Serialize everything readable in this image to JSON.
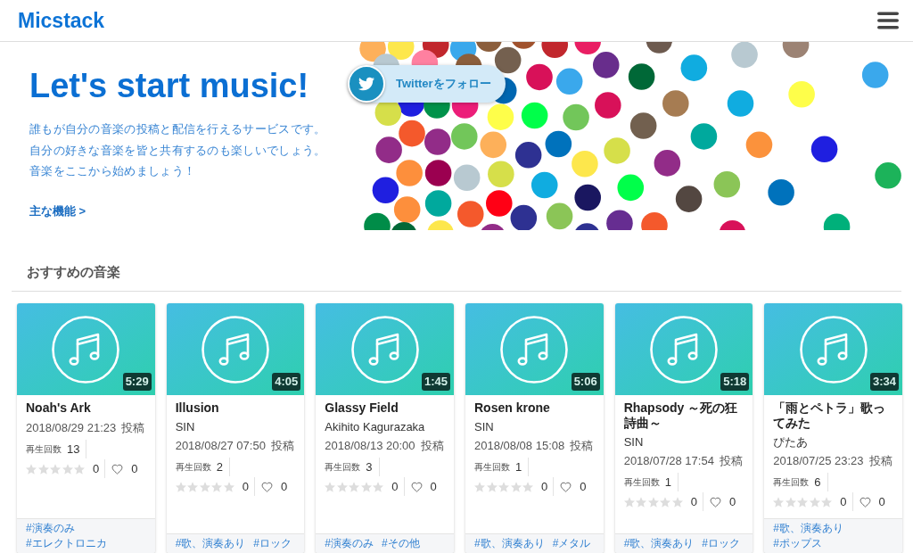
{
  "header": {
    "logo": "Micstack"
  },
  "hero": {
    "title": "Let's start music!",
    "description": [
      "誰もが自分の音楽の投稿と配信を行えるサービスです。",
      "自分の好きな音楽を皆と共有するのも楽しいでしょう。",
      "音楽をここから始めましょう！"
    ],
    "link": "主な機能 >",
    "twitter_button": "Twitterをフォロー"
  },
  "recommended": {
    "title": "おすすめの音楽",
    "songs": [
      {
        "title": "Noah's Ark",
        "duration": "5:29",
        "posted_at": "2018/08/29 21:23",
        "posted_label": "投稿",
        "plays_label": "再生回数",
        "plays": "13",
        "stars": 0,
        "rating": "0",
        "likes": "0",
        "tags": [
          "#演奏のみ",
          "#エレクトロニカ"
        ]
      },
      {
        "title": "Illusion",
        "artist": "SIN",
        "duration": "4:05",
        "posted_at": "2018/08/27 07:50",
        "posted_label": "投稿",
        "plays_label": "再生回数",
        "plays": "2",
        "stars": 0,
        "rating": "0",
        "likes": "0",
        "tags": [
          "#歌、演奏あり",
          "#ロック"
        ]
      },
      {
        "title": "Glassy Field",
        "artist": "Akihito Kagurazaka",
        "duration": "1:45",
        "posted_at": "2018/08/13 20:00",
        "posted_label": "投稿",
        "plays_label": "再生回数",
        "plays": "3",
        "stars": 0,
        "rating": "0",
        "likes": "0",
        "tags": [
          "#演奏のみ",
          "#その他"
        ]
      },
      {
        "title": "Rosen krone",
        "artist": "SIN",
        "duration": "5:06",
        "posted_at": "2018/08/08 15:08",
        "posted_label": "投稿",
        "plays_label": "再生回数",
        "plays": "1",
        "stars": 0,
        "rating": "0",
        "likes": "0",
        "tags": [
          "#歌、演奏あり",
          "#メタル"
        ]
      },
      {
        "title": "Rhapsody ～死の狂詩曲～",
        "artist": "SIN",
        "duration": "5:18",
        "posted_at": "2018/07/28 17:54",
        "posted_label": "投稿",
        "plays_label": "再生回数",
        "plays": "1",
        "stars": 0,
        "rating": "0",
        "likes": "0",
        "tags": [
          "#歌、演奏あり",
          "#ロック"
        ]
      },
      {
        "title": "「雨とペトラ」歌ってみた",
        "artist": "ぴたあ",
        "duration": "3:34",
        "posted_at": "2018/07/25 23:23",
        "posted_label": "投稿",
        "plays_label": "再生回数",
        "plays": "6",
        "stars": 0,
        "rating": "0",
        "likes": "0",
        "tags": [
          "#歌、演奏あり",
          "#ポップス"
        ]
      }
    ]
  }
}
